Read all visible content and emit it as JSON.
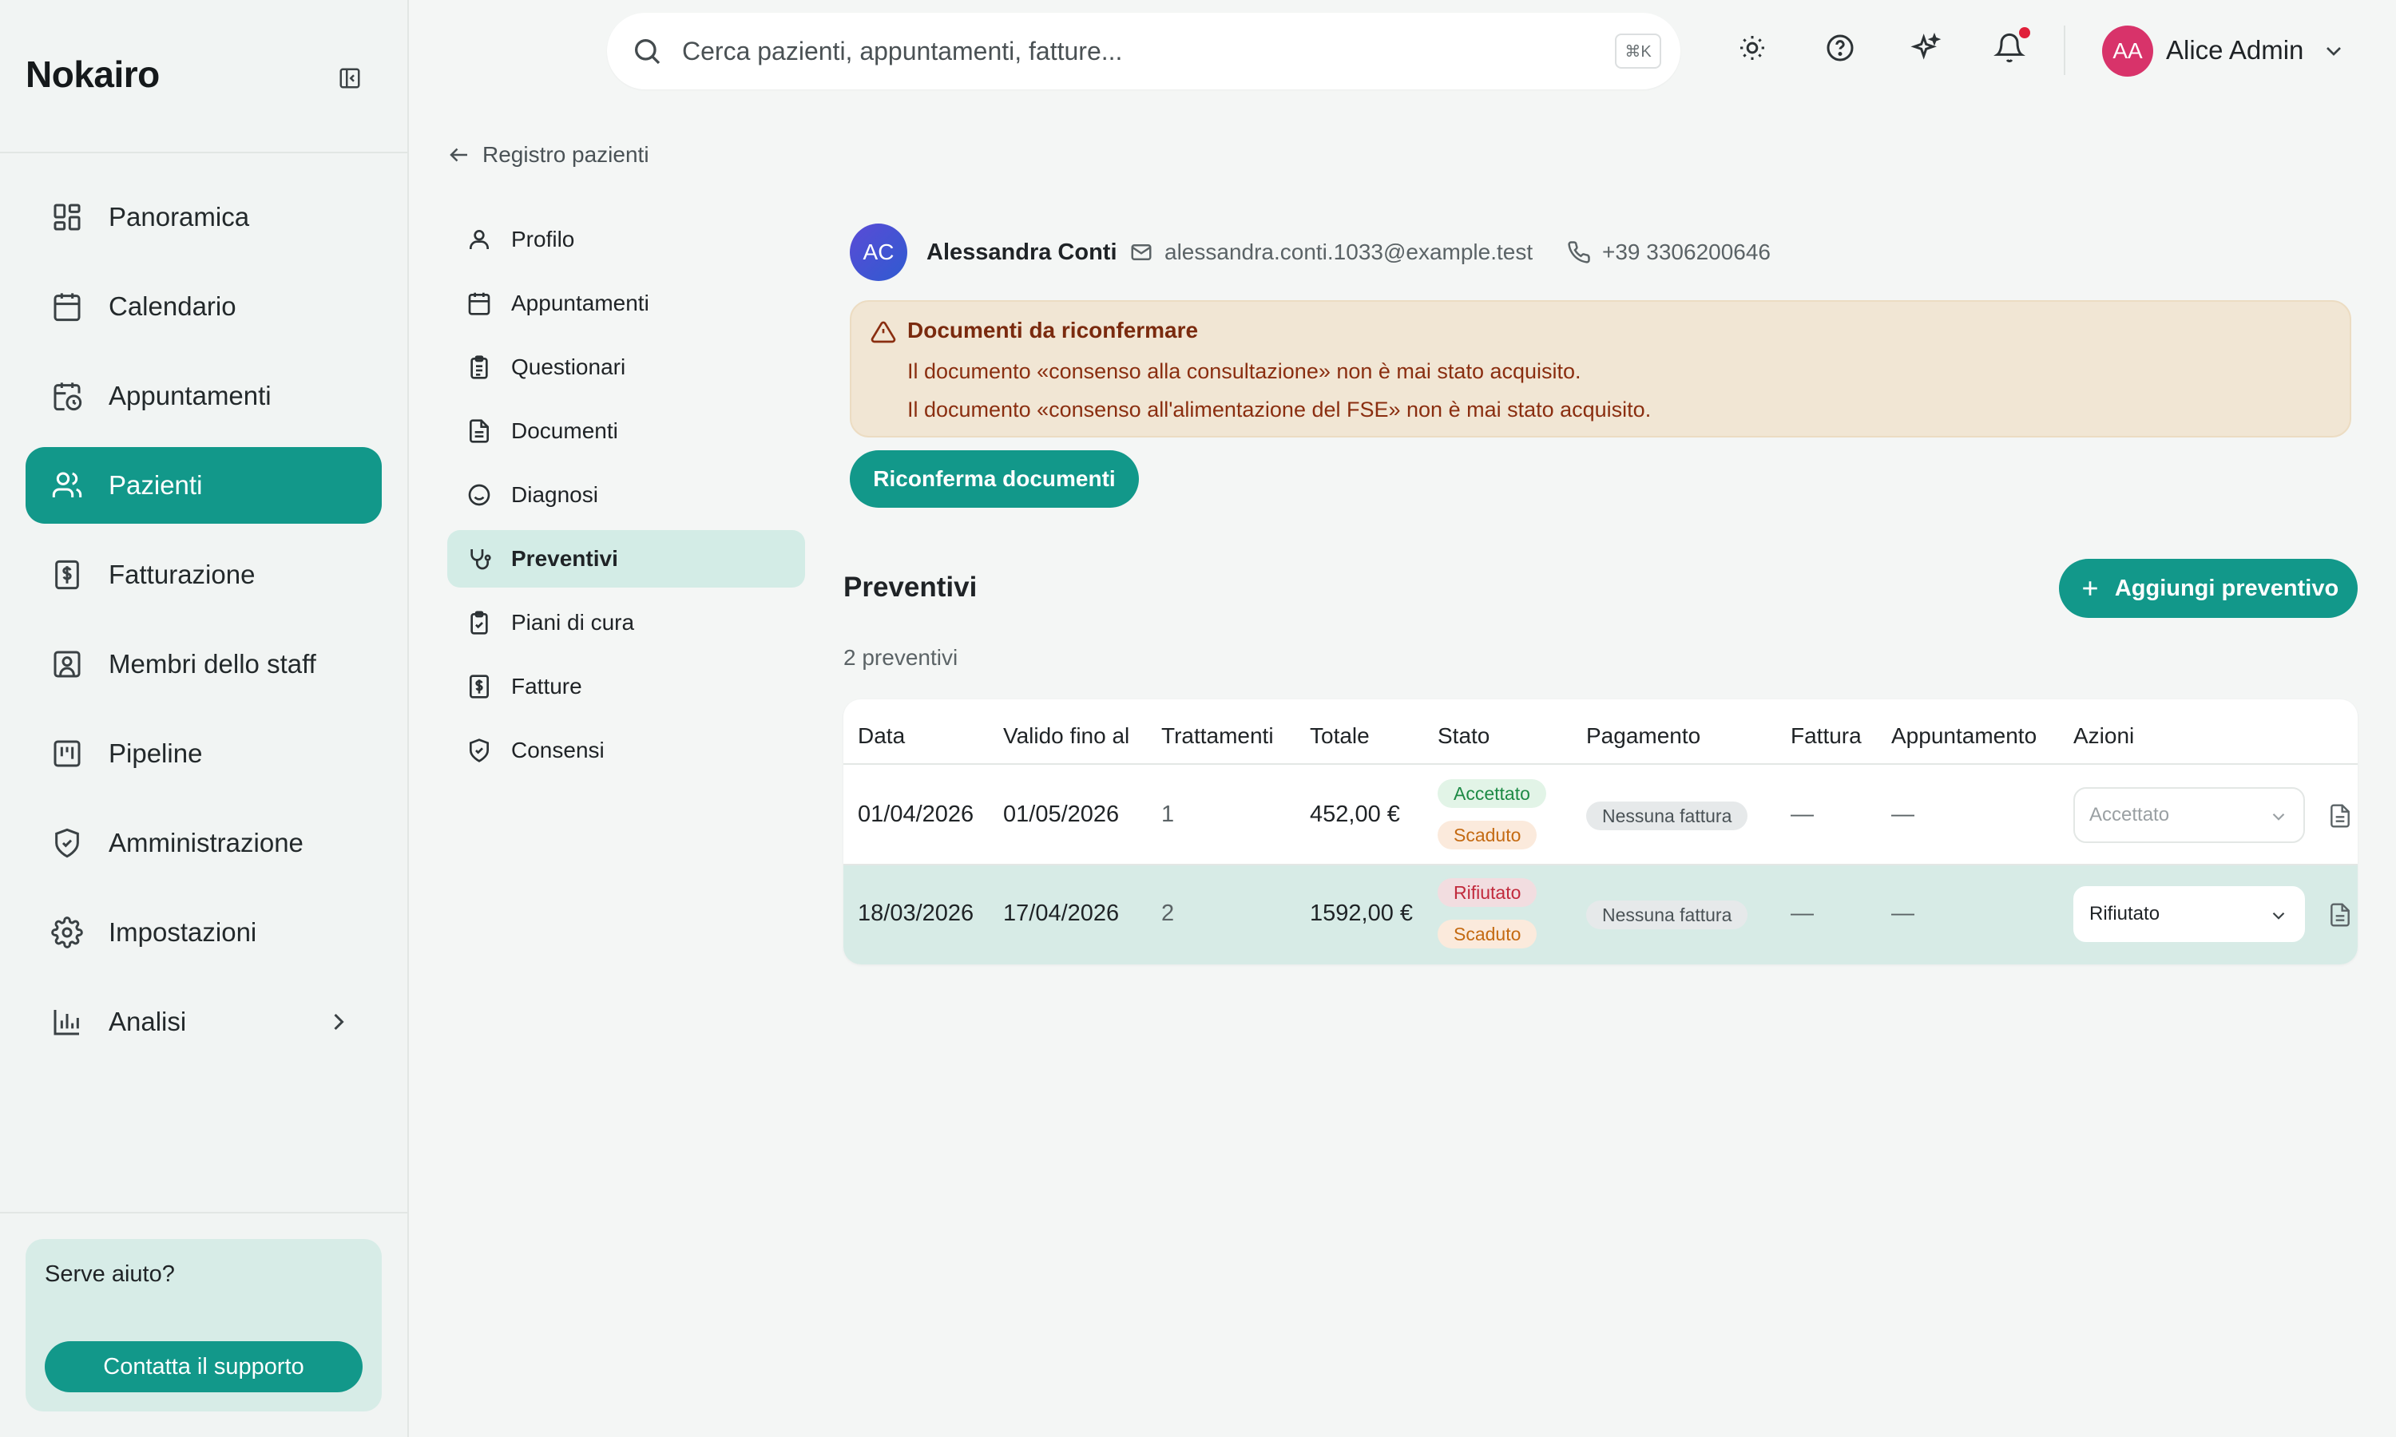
{
  "brand": "Nokairo",
  "sidebar": {
    "items": [
      {
        "label": "Panoramica",
        "icon": "dashboard-icon"
      },
      {
        "label": "Calendario",
        "icon": "calendar-icon"
      },
      {
        "label": "Appuntamenti",
        "icon": "calendar-clock-icon"
      },
      {
        "label": "Pazienti",
        "icon": "users-icon",
        "active": true
      },
      {
        "label": "Fatturazione",
        "icon": "invoice-icon"
      },
      {
        "label": "Membri dello staff",
        "icon": "id-badge-icon"
      },
      {
        "label": "Pipeline",
        "icon": "kanban-icon"
      },
      {
        "label": "Amministrazione",
        "icon": "shield-icon"
      },
      {
        "label": "Impostazioni",
        "icon": "gear-icon"
      },
      {
        "label": "Analisi",
        "icon": "bar-chart-icon"
      }
    ],
    "help": {
      "title": "Serve aiuto?",
      "button": "Contatta il supporto"
    }
  },
  "topbar": {
    "search_placeholder": "Cerca pazienti, appuntamenti, fatture...",
    "shortcut": "⌘K",
    "user": {
      "initials": "AA",
      "name": "Alice Admin"
    }
  },
  "breadcrumb": {
    "back_label": "Registro pazienti"
  },
  "subnav": {
    "items": [
      {
        "label": "Profilo",
        "icon": "user-icon"
      },
      {
        "label": "Appuntamenti",
        "icon": "calendar-icon"
      },
      {
        "label": "Questionari",
        "icon": "clipboard-list-icon"
      },
      {
        "label": "Documenti",
        "icon": "file-text-icon"
      },
      {
        "label": "Diagnosi",
        "icon": "smile-icon"
      },
      {
        "label": "Preventivi",
        "icon": "stethoscope-icon",
        "active": true
      },
      {
        "label": "Piani di cura",
        "icon": "clipboard-check-icon"
      },
      {
        "label": "Fatture",
        "icon": "receipt-icon"
      },
      {
        "label": "Consensi",
        "icon": "shield-check-icon"
      }
    ]
  },
  "patient": {
    "initials": "AC",
    "name": "Alessandra Conti",
    "email": "alessandra.conti.1033@example.test",
    "phone": "+39 3306200646"
  },
  "alert": {
    "title": "Documenti da riconfermare",
    "lines": [
      "Il documento «consenso alla consultazione» non è mai stato acquisito.",
      "Il documento «consenso all'alimentazione del FSE» non è mai stato acquisito."
    ],
    "button": "Riconferma documenti"
  },
  "section": {
    "title": "Preventivi",
    "add_button": "Aggiungi preventivo",
    "count": "2 preventivi"
  },
  "table": {
    "headers": [
      "Data",
      "Valido fino al",
      "Trattamenti",
      "Totale",
      "Stato",
      "Pagamento",
      "Fattura",
      "Appuntamento",
      "Azioni"
    ],
    "rows": [
      {
        "data": "01/04/2026",
        "valido": "01/05/2026",
        "trattamenti": "1",
        "totale": "452,00 €",
        "stato": [
          "Accettato",
          "Scaduto"
        ],
        "pagamento": "Nessuna fattura",
        "fattura": "—",
        "appuntamento": "—",
        "azione": "Accettato"
      },
      {
        "data": "18/03/2026",
        "valido": "17/04/2026",
        "trattamenti": "2",
        "totale": "1592,00 €",
        "stato": [
          "Rifiutato",
          "Scaduto"
        ],
        "pagamento": "Nessuna fattura",
        "fattura": "—",
        "appuntamento": "—",
        "azione": "Rifiutato"
      }
    ]
  },
  "colors": {
    "accent": "#12988a",
    "alert_bg": "#f1e6d4",
    "alert_text": "#8a2e10",
    "selected_row": "#d7ebe6"
  }
}
